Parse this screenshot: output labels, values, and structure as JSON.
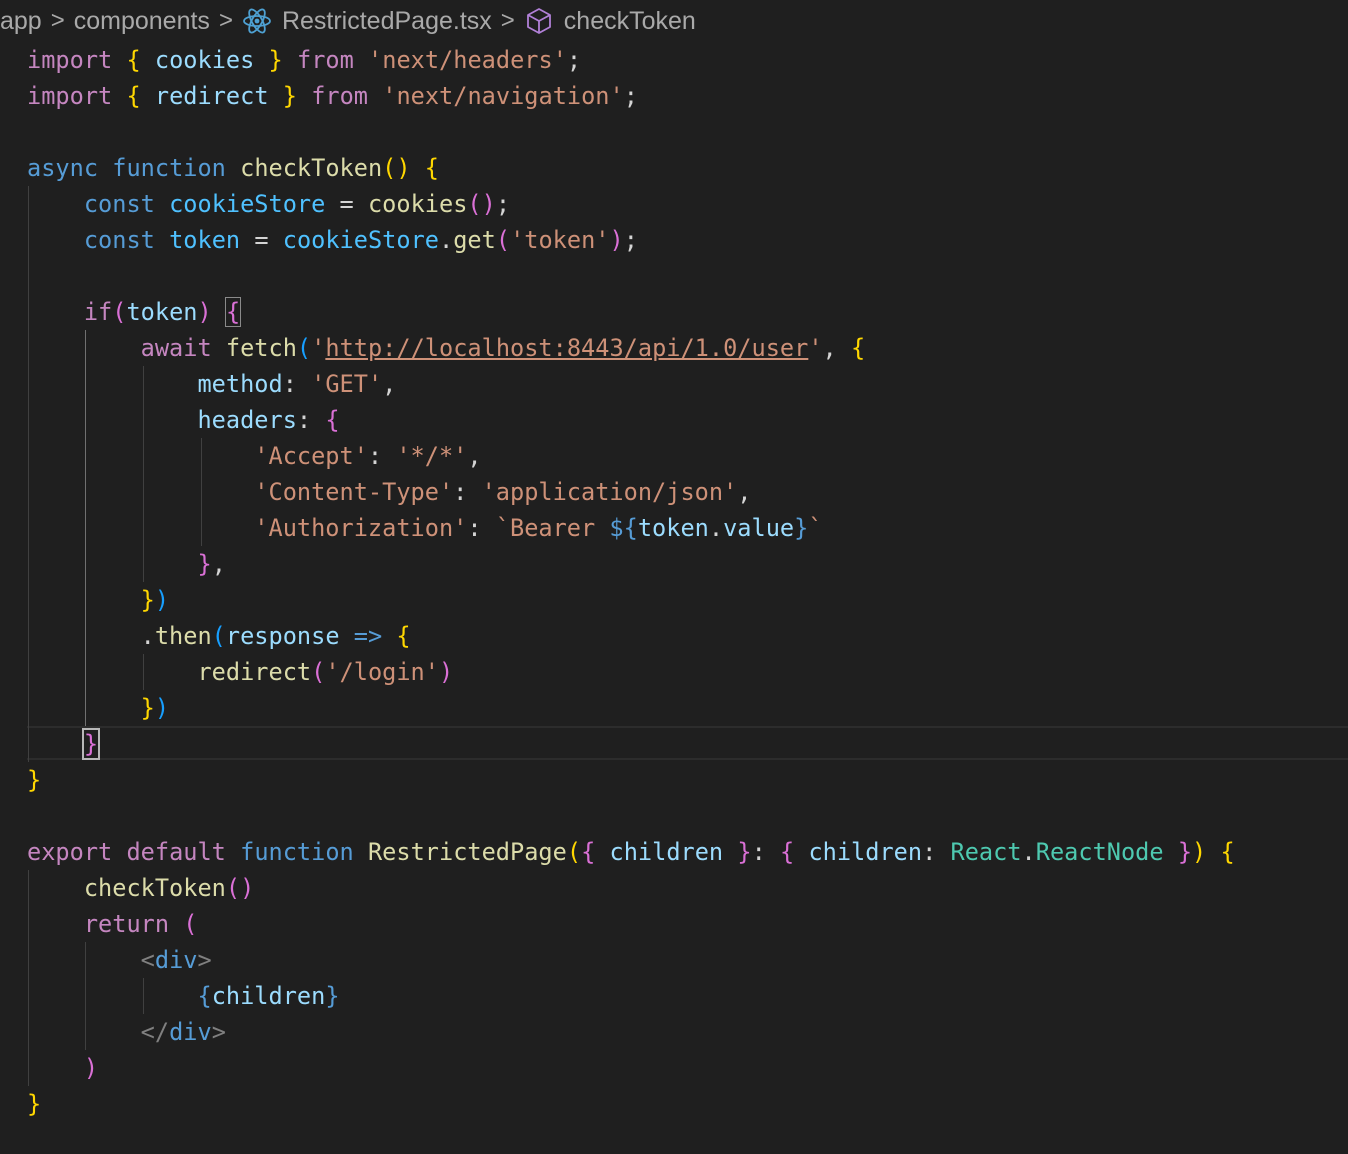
{
  "breadcrumb": {
    "items": [
      "app",
      "components",
      "RestrictedPage.tsx",
      "checkToken"
    ],
    "separator": ">"
  },
  "code": {
    "language": "tsx",
    "lines": [
      [
        [
          "kw",
          "import"
        ],
        [
          "pl",
          " "
        ],
        [
          "b1",
          "{"
        ],
        [
          "pl",
          " "
        ],
        [
          "var",
          "cookies"
        ],
        [
          "pl",
          " "
        ],
        [
          "b1",
          "}"
        ],
        [
          "pl",
          " "
        ],
        [
          "kw",
          "from"
        ],
        [
          "pl",
          " "
        ],
        [
          "str",
          "'next/headers'"
        ],
        [
          "pl",
          ";"
        ]
      ],
      [
        [
          "kw",
          "import"
        ],
        [
          "pl",
          " "
        ],
        [
          "b1",
          "{"
        ],
        [
          "pl",
          " "
        ],
        [
          "var",
          "redirect"
        ],
        [
          "pl",
          " "
        ],
        [
          "b1",
          "}"
        ],
        [
          "pl",
          " "
        ],
        [
          "kw",
          "from"
        ],
        [
          "pl",
          " "
        ],
        [
          "str",
          "'next/navigation'"
        ],
        [
          "pl",
          ";"
        ]
      ],
      [],
      [
        [
          "st",
          "async"
        ],
        [
          "pl",
          " "
        ],
        [
          "st",
          "function"
        ],
        [
          "pl",
          " "
        ],
        [
          "fn",
          "checkToken"
        ],
        [
          "b1",
          "()"
        ],
        [
          "pl",
          " "
        ],
        [
          "b1",
          "{"
        ]
      ],
      [
        [
          "pl",
          "    "
        ],
        [
          "st",
          "const"
        ],
        [
          "pl",
          " "
        ],
        [
          "cst",
          "cookieStore"
        ],
        [
          "pl",
          " = "
        ],
        [
          "fn",
          "cookies"
        ],
        [
          "b2",
          "()"
        ],
        [
          "pl",
          ";"
        ]
      ],
      [
        [
          "pl",
          "    "
        ],
        [
          "st",
          "const"
        ],
        [
          "pl",
          " "
        ],
        [
          "cst",
          "token"
        ],
        [
          "pl",
          " = "
        ],
        [
          "cst",
          "cookieStore"
        ],
        [
          "pl",
          "."
        ],
        [
          "fn",
          "get"
        ],
        [
          "b2",
          "("
        ],
        [
          "str",
          "'token'"
        ],
        [
          "b2",
          ")"
        ],
        [
          "pl",
          ";"
        ]
      ],
      [],
      [
        [
          "pl",
          "    "
        ],
        [
          "kw",
          "if"
        ],
        [
          "b2",
          "("
        ],
        [
          "var",
          "token"
        ],
        [
          "b2",
          ")"
        ],
        [
          "pl",
          " "
        ],
        [
          "b2 bracket-box",
          "{"
        ]
      ],
      [
        [
          "pl",
          "        "
        ],
        [
          "kw",
          "await"
        ],
        [
          "pl",
          " "
        ],
        [
          "fn",
          "fetch"
        ],
        [
          "b3",
          "("
        ],
        [
          "str",
          "'"
        ],
        [
          "str url",
          "http://localhost:8443/api/1.0/user"
        ],
        [
          "str",
          "'"
        ],
        [
          "pl",
          ", "
        ],
        [
          "b1",
          "{"
        ]
      ],
      [
        [
          "pl",
          "            "
        ],
        [
          "var",
          "method"
        ],
        [
          "pl",
          ": "
        ],
        [
          "str",
          "'GET'"
        ],
        [
          "pl",
          ","
        ]
      ],
      [
        [
          "pl",
          "            "
        ],
        [
          "var",
          "headers"
        ],
        [
          "pl",
          ": "
        ],
        [
          "b2",
          "{"
        ]
      ],
      [
        [
          "pl",
          "                "
        ],
        [
          "str",
          "'Accept'"
        ],
        [
          "pl",
          ": "
        ],
        [
          "str",
          "'*/*'"
        ],
        [
          "pl",
          ","
        ]
      ],
      [
        [
          "pl",
          "                "
        ],
        [
          "str",
          "'Content-Type'"
        ],
        [
          "pl",
          ": "
        ],
        [
          "str",
          "'application/json'"
        ],
        [
          "pl",
          ","
        ]
      ],
      [
        [
          "pl",
          "                "
        ],
        [
          "str",
          "'Authorization'"
        ],
        [
          "pl",
          ": "
        ],
        [
          "str",
          "`Bearer "
        ],
        [
          "st",
          "${"
        ],
        [
          "var",
          "token"
        ],
        [
          "pl",
          "."
        ],
        [
          "var",
          "value"
        ],
        [
          "st",
          "}"
        ],
        [
          "str",
          "`"
        ]
      ],
      [
        [
          "pl",
          "            "
        ],
        [
          "b2",
          "}"
        ],
        [
          "pl",
          ","
        ]
      ],
      [
        [
          "pl",
          "        "
        ],
        [
          "b1",
          "}"
        ],
        [
          "b3",
          ")"
        ]
      ],
      [
        [
          "pl",
          "        ."
        ],
        [
          "fn",
          "then"
        ],
        [
          "b3",
          "("
        ],
        [
          "var",
          "response"
        ],
        [
          "pl",
          " "
        ],
        [
          "st",
          "=>"
        ],
        [
          "pl",
          " "
        ],
        [
          "b1",
          "{"
        ]
      ],
      [
        [
          "pl",
          "            "
        ],
        [
          "fn",
          "redirect"
        ],
        [
          "b2",
          "("
        ],
        [
          "str",
          "'/login'"
        ],
        [
          "b2",
          ")"
        ]
      ],
      [
        [
          "pl",
          "        "
        ],
        [
          "b1",
          "}"
        ],
        [
          "b3",
          ")"
        ]
      ],
      [
        [
          "pl",
          "    "
        ],
        [
          "b2 cursor-box",
          "}"
        ]
      ],
      [
        [
          "b1",
          "}"
        ]
      ],
      [],
      [
        [
          "kw",
          "export"
        ],
        [
          "pl",
          " "
        ],
        [
          "kw",
          "default"
        ],
        [
          "pl",
          " "
        ],
        [
          "st",
          "function"
        ],
        [
          "pl",
          " "
        ],
        [
          "fn",
          "RestrictedPage"
        ],
        [
          "b1",
          "("
        ],
        [
          "b2",
          "{"
        ],
        [
          "pl",
          " "
        ],
        [
          "var",
          "children"
        ],
        [
          "pl",
          " "
        ],
        [
          "b2",
          "}"
        ],
        [
          "pl",
          ": "
        ],
        [
          "b2",
          "{"
        ],
        [
          "pl",
          " "
        ],
        [
          "var",
          "children"
        ],
        [
          "pl",
          ": "
        ],
        [
          "typ",
          "React"
        ],
        [
          "pl",
          "."
        ],
        [
          "typ",
          "ReactNode"
        ],
        [
          "pl",
          " "
        ],
        [
          "b2",
          "}"
        ],
        [
          "b1",
          ")"
        ],
        [
          "pl",
          " "
        ],
        [
          "b1",
          "{"
        ]
      ],
      [
        [
          "pl",
          "    "
        ],
        [
          "fn",
          "checkToken"
        ],
        [
          "b2",
          "()"
        ]
      ],
      [
        [
          "pl",
          "    "
        ],
        [
          "kw",
          "return"
        ],
        [
          "pl",
          " "
        ],
        [
          "b2",
          "("
        ]
      ],
      [
        [
          "pl",
          "        "
        ],
        [
          "tag",
          "<"
        ],
        [
          "tn",
          "div"
        ],
        [
          "tag",
          ">"
        ]
      ],
      [
        [
          "pl",
          "            "
        ],
        [
          "st",
          "{"
        ],
        [
          "var",
          "children"
        ],
        [
          "st",
          "}"
        ]
      ],
      [
        [
          "pl",
          "        "
        ],
        [
          "tag",
          "</"
        ],
        [
          "tn",
          "div"
        ],
        [
          "tag",
          ">"
        ]
      ],
      [
        [
          "pl",
          "    "
        ],
        [
          "b2",
          ")"
        ]
      ],
      [
        [
          "b1",
          "}"
        ]
      ]
    ]
  }
}
